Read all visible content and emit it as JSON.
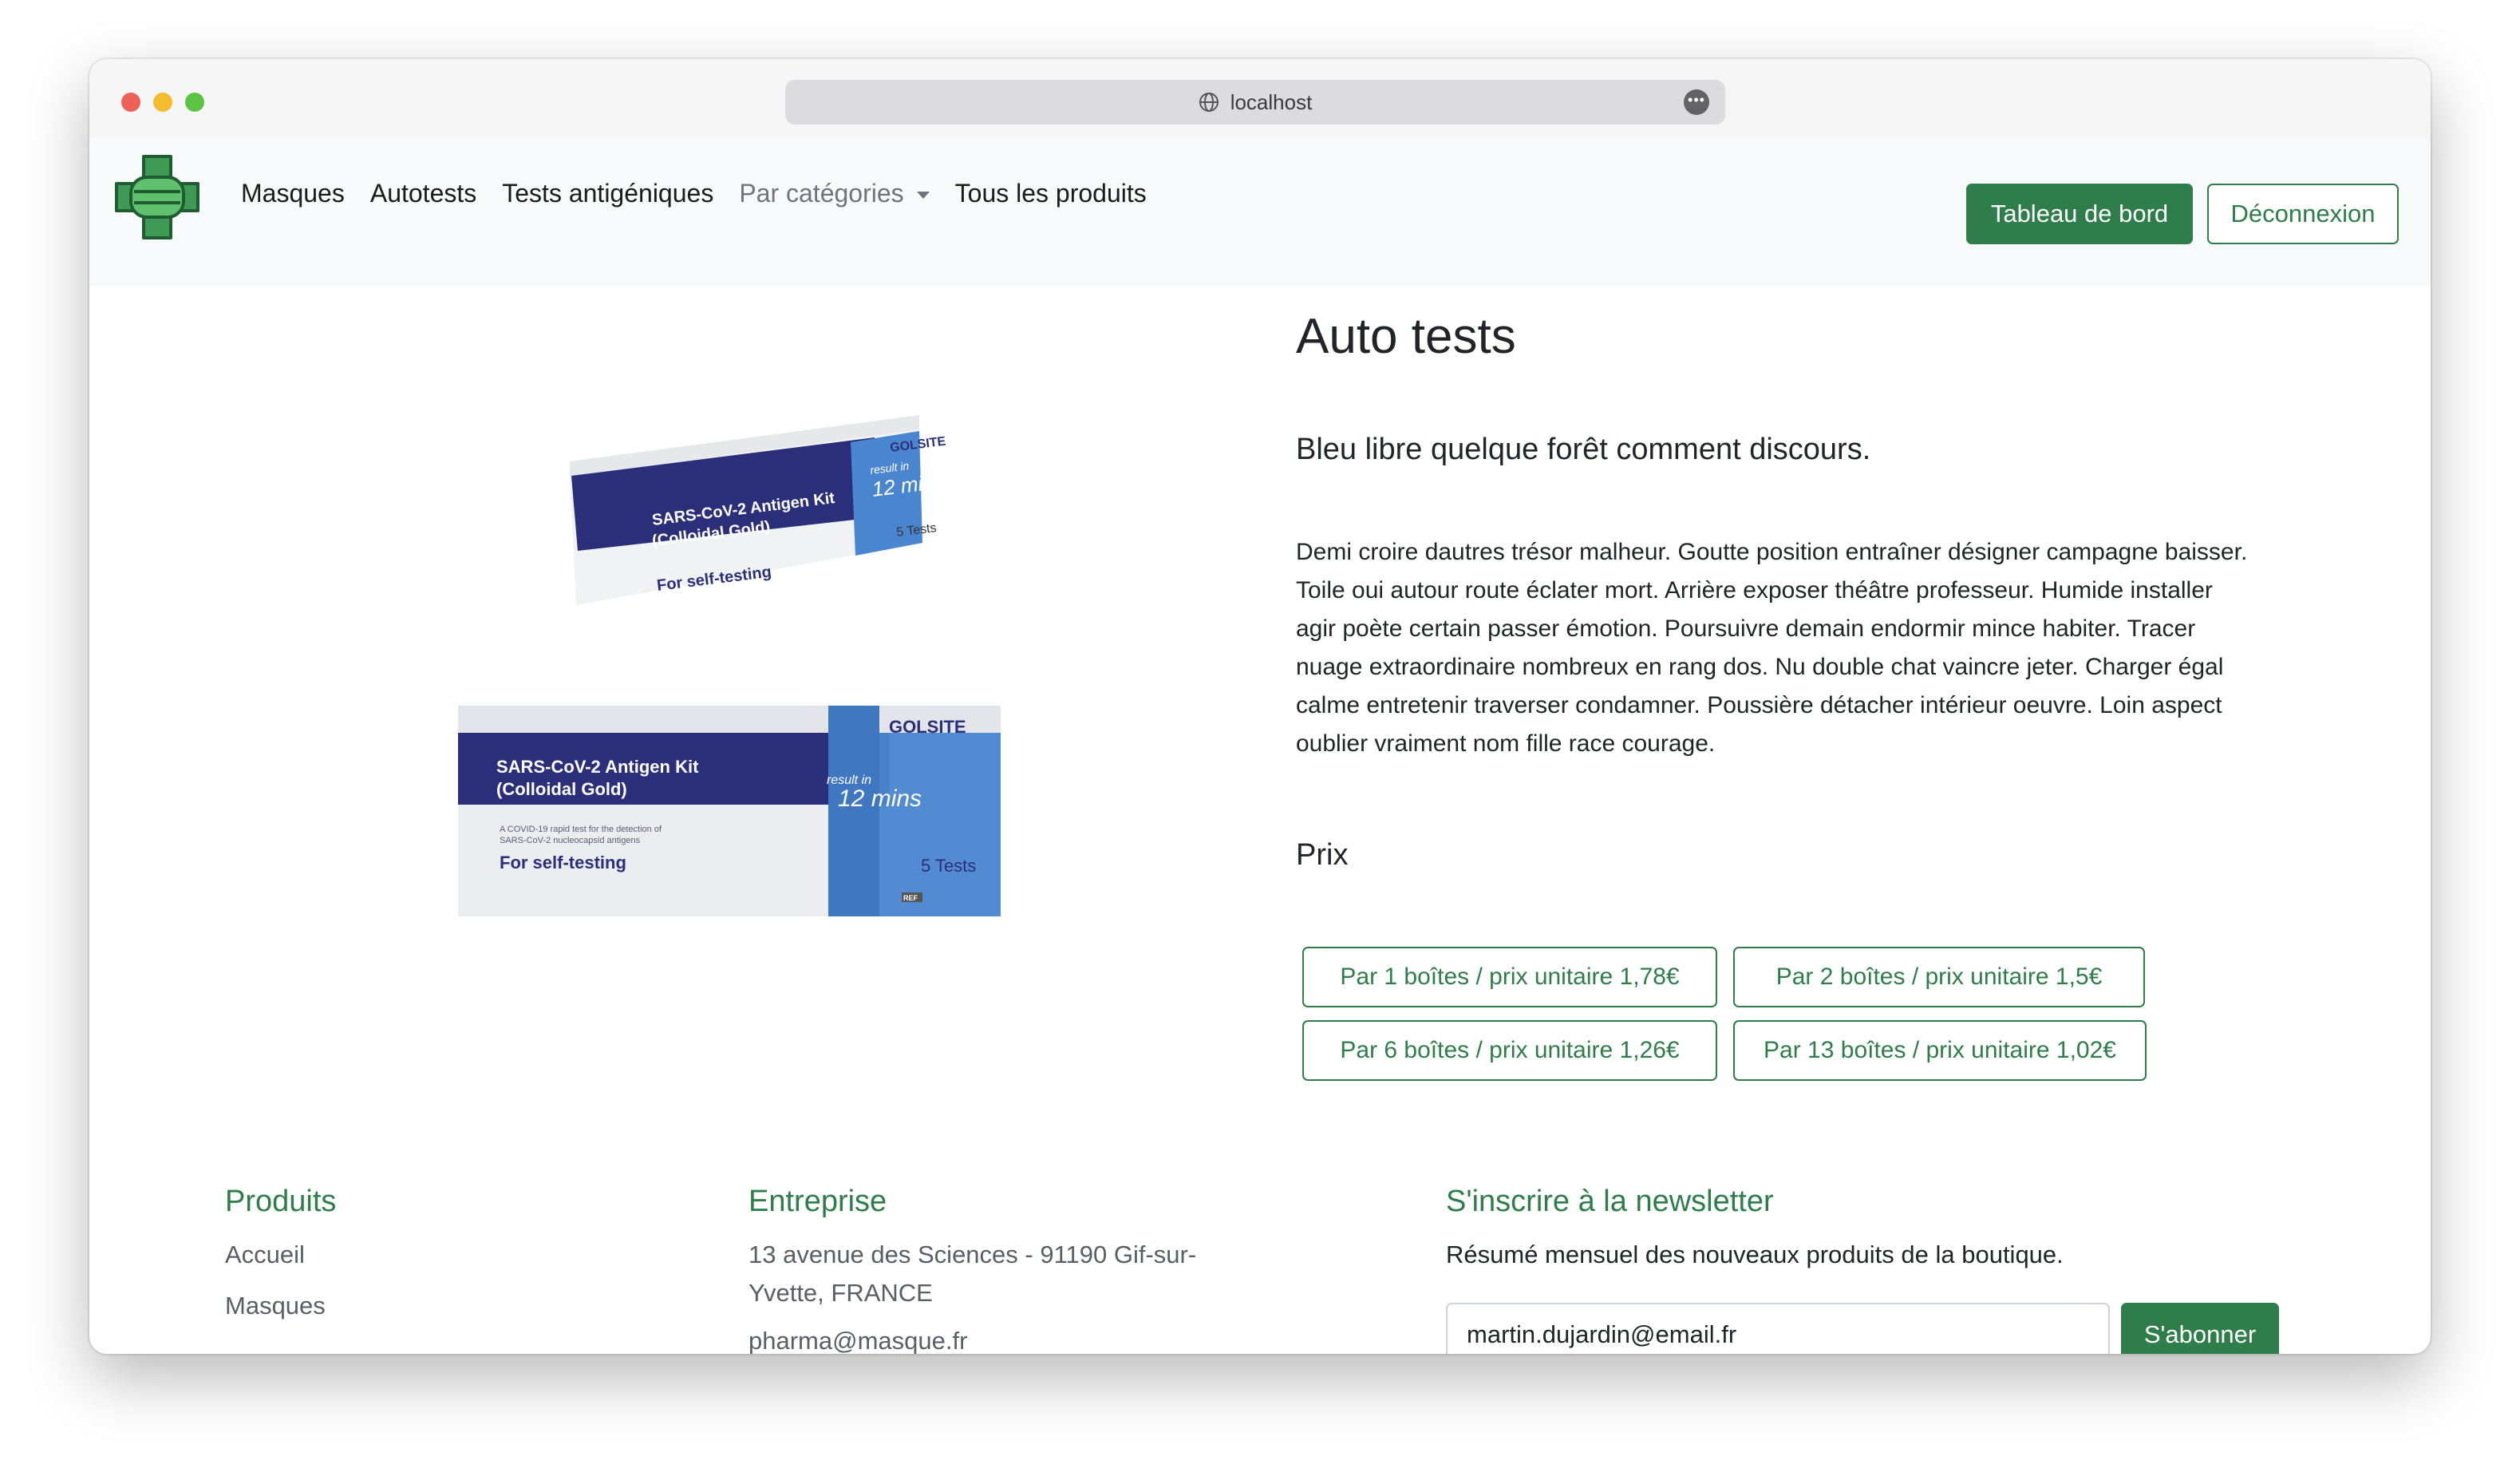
{
  "browser": {
    "url": "localhost"
  },
  "nav": {
    "links": [
      "Masques",
      "Autotests",
      "Tests antigéniques"
    ],
    "dropdown_label": "Par catégories",
    "all_products": "Tous les produits",
    "dashboard_button": "Tableau de bord",
    "logout_button": "Déconnexion"
  },
  "product": {
    "title": "Auto tests",
    "subtitle": "Bleu libre quelque forêt comment discours.",
    "description": "Demi croire dautres trésor malheur. Goutte position entraîner désigner campagne baisser. Toile oui autour route éclater mort. Arrière exposer théâtre professeur. Humide installer agir poète certain passer émotion. Poursuivre demain endormir mince habiter. Tracer nuage extraordinaire nombreux en rang dos. Nu double chat vaincre jeter. Charger égal calme entretenir traverser condamner. Poussière détacher intérieur oeuvre. Loin aspect oublier vraiment nom fille race courage.",
    "price_label": "Prix",
    "price_options": [
      "Par 1 boîtes / prix unitaire 1,78€",
      "Par 2 boîtes / prix unitaire 1,5€",
      "Par 6 boîtes / prix unitaire 1,26€",
      "Par 13 boîtes / prix unitaire 1,02€"
    ],
    "image_text": {
      "brand": "GOLSITE",
      "kit_name_1": "SARS-CoV-2 Antigen Kit",
      "kit_name_2": "(Colloidal Gold)",
      "result_in": "result in",
      "minutes": "12 mins",
      "tests": "5 Tests",
      "self_testing": "For self-testing",
      "fine_print_1": "A COVID-19 rapid test for the detection of",
      "fine_print_2": "SARS-CoV-2 nucleocapsid antigens",
      "ref": "REF"
    }
  },
  "footer": {
    "products_heading": "Produits",
    "products_links": [
      "Accueil",
      "Masques"
    ],
    "company_heading": "Entreprise",
    "company_address_1": "13 avenue des Sciences - 91190 Gif-sur-",
    "company_address_2": "Yvette, FRANCE",
    "company_email": "pharma@masque.fr",
    "newsletter_heading": "S'inscrire à la newsletter",
    "newsletter_text": "Résumé mensuel des nouveaux produits de la boutique.",
    "newsletter_email_value": "martin.dujardin@email.fr",
    "subscribe_button": "S'abonner"
  },
  "colors": {
    "brand_green": "#2e7d4a",
    "kit_navy": "#2b2f7a",
    "kit_blue": "#4a86cf"
  }
}
